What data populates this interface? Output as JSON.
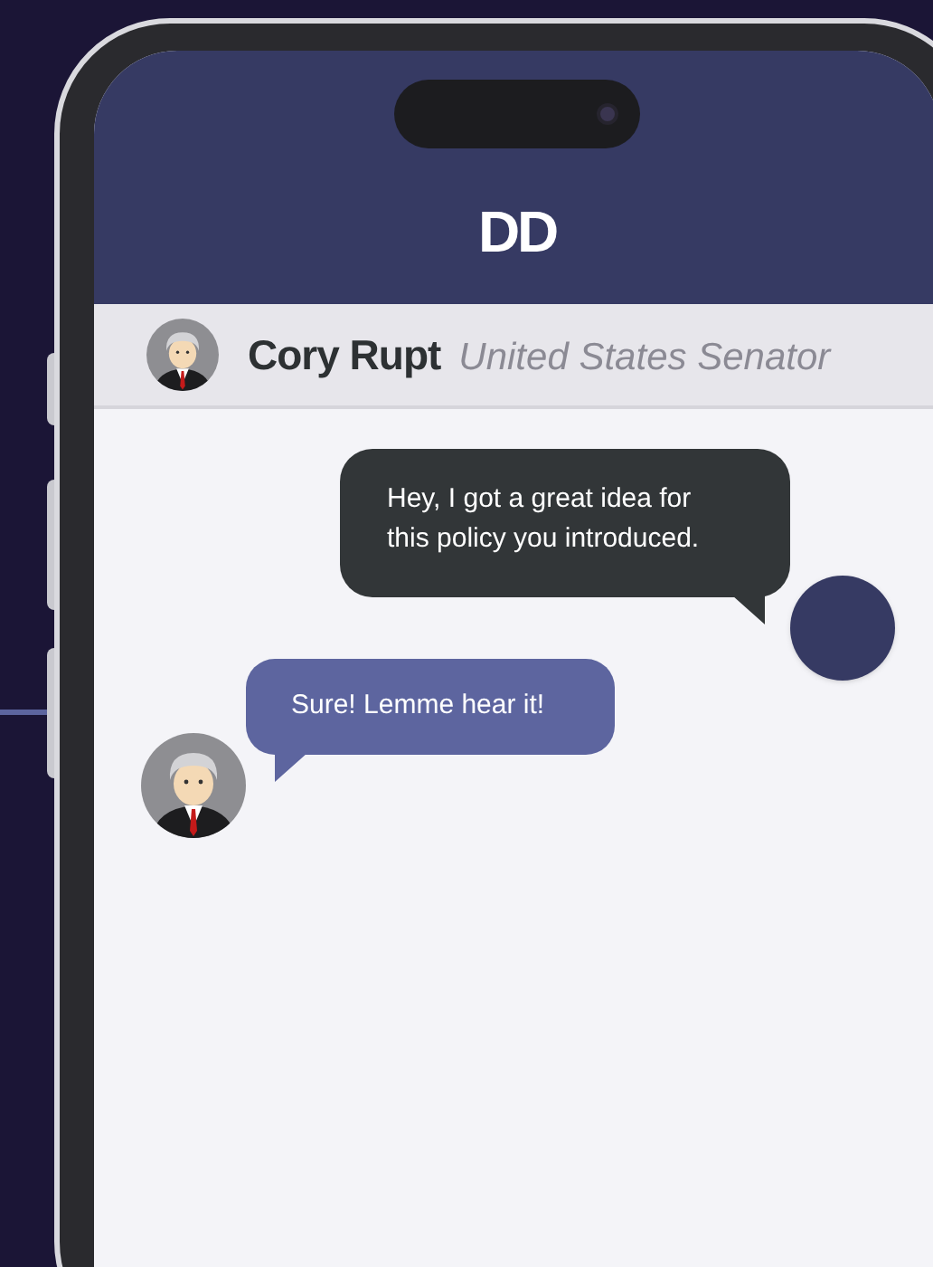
{
  "header": {
    "logo": "DD"
  },
  "contact": {
    "name": "Cory Rupt",
    "title": "United States Senator"
  },
  "messages": [
    {
      "kind": "sent",
      "text": "Hey, I got a great idea for this policy you introduced."
    },
    {
      "kind": "received",
      "text": "Sure! Lemme hear it!"
    }
  ]
}
